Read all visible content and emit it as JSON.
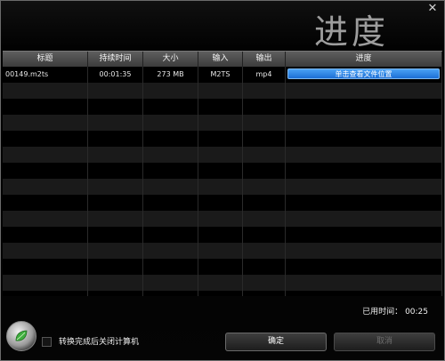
{
  "window": {
    "title": "进度",
    "close_glyph": "✕"
  },
  "table": {
    "columns": [
      "标题",
      "持续时间",
      "大小",
      "输入",
      "输出",
      "进度"
    ],
    "rows": [
      {
        "title": "00149.m2ts",
        "duration": "00:01:35",
        "size": "273 MB",
        "input": "M2TS",
        "output": "mp4",
        "progress_label": "单击查看文件位置"
      }
    ],
    "empty_row_count": 14
  },
  "status": {
    "elapsed_label": "已用时间：",
    "elapsed_value": "00:25"
  },
  "footer": {
    "shutdown_label": "转换完成后关闭计算机",
    "shutdown_checked": false,
    "ok_label": "确定",
    "cancel_label": "取消"
  },
  "icons": {
    "logo": "leaf-logo-icon",
    "close": "close-icon"
  },
  "colors": {
    "progress_button": "#2a82e4",
    "background": "#000000",
    "title": "#9d9d9d"
  }
}
